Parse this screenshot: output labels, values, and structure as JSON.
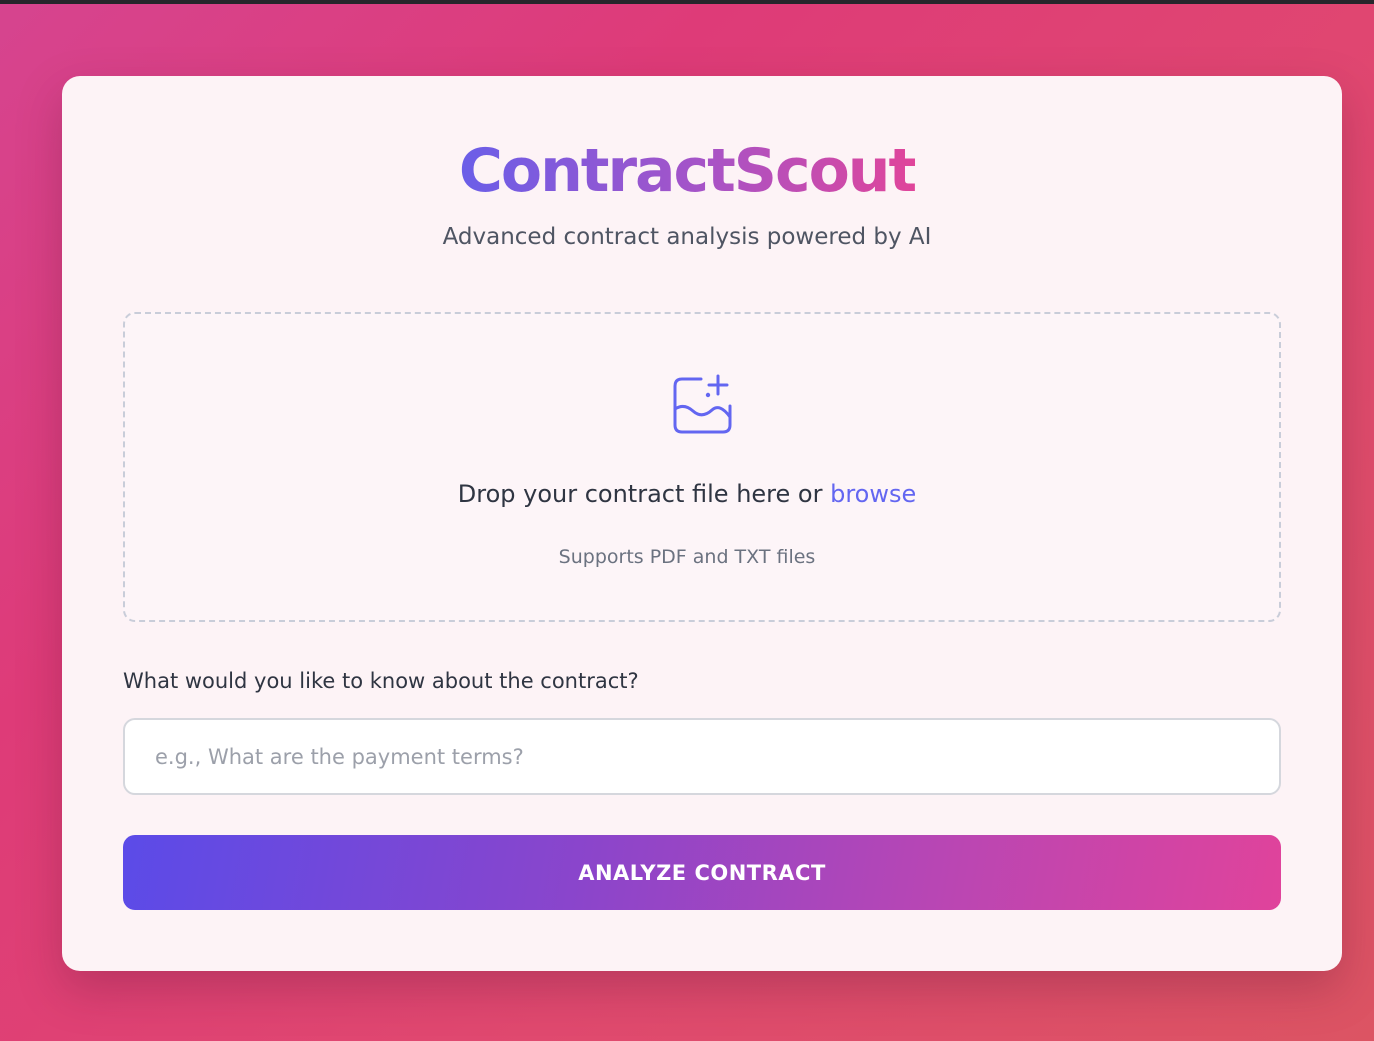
{
  "app": {
    "title": "ContractScout",
    "subtitle": "Advanced contract analysis powered by AI"
  },
  "upload": {
    "icon": "image-plus-icon",
    "prompt": "Drop your contract file here or ",
    "browse_label": "browse",
    "support_text": "Supports PDF and TXT files"
  },
  "question": {
    "label": "What would you like to know about the contract?",
    "placeholder": "e.g., What are the payment terms?",
    "value": ""
  },
  "actions": {
    "analyze_label": "ANALYZE CONTRACT"
  },
  "colors": {
    "accent": "#6366f1",
    "brand_gradient_start": "#6a5ee8",
    "brand_gradient_end": "#e0459a",
    "background_start": "#d6448f",
    "background_end": "#dc5463"
  }
}
